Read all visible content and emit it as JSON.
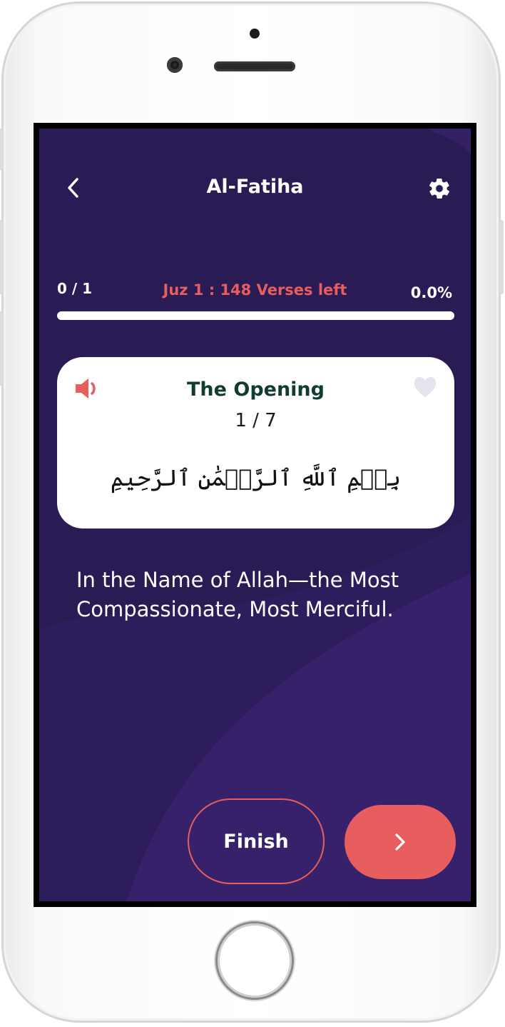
{
  "header": {
    "title": "Al-Fatiha",
    "back_icon": "chevron-left-icon",
    "settings_icon": "gear-icon"
  },
  "progress": {
    "count": "0 / 1",
    "remaining": "Juz 1 : 148 Verses left",
    "percent_label": "0.0%",
    "percent_value": 0.0
  },
  "card": {
    "title": "The Opening",
    "verse_counter": "1 / 7",
    "arabic": "بِسۡمِ ٱللَّهِ ٱلرَّحۡمَٰنِ ٱلرَّحِيمِ",
    "sound_icon": "speaker-icon",
    "favorite_icon": "heart-icon"
  },
  "translation": "In the Name of Allah—the Most Compassionate, Most Merciful.",
  "actions": {
    "finish_label": "Finish",
    "next_icon": "chevron-right-icon"
  },
  "colors": {
    "background": "#2a1b55",
    "accent": "#e85d5d",
    "card": "#ffffff",
    "card_title": "#123b33"
  }
}
